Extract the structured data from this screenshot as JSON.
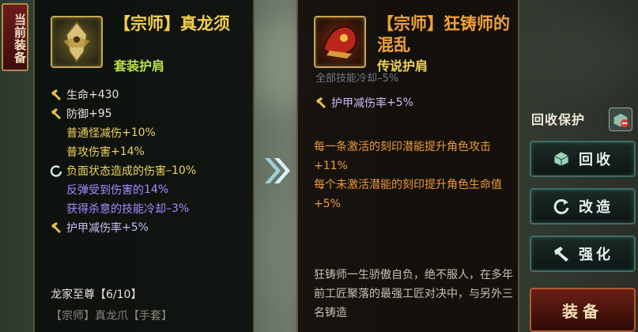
{
  "equip_tag": "当前装备",
  "left_item": {
    "name": "【宗师】真龙须",
    "type": "套装护肩",
    "stats": [
      {
        "kind": "main",
        "icon": "hammer-icon",
        "label": "生命",
        "value": "+430",
        "color": "white"
      },
      {
        "kind": "main",
        "icon": "hammer-icon",
        "label": "防御",
        "value": "+95",
        "color": "white"
      },
      {
        "kind": "sub",
        "icon": "",
        "label": "普通怪减伤",
        "value": "+10%",
        "color": "yellow"
      },
      {
        "kind": "sub",
        "icon": "",
        "label": "普攻伤害",
        "value": "+14%",
        "color": "yellow"
      },
      {
        "kind": "sub",
        "icon": "refresh-icon",
        "label": "负面状态造成的伤害",
        "value": "–10%",
        "color": "yellow"
      },
      {
        "kind": "sub",
        "icon": "",
        "label": "反弹受到伤害的",
        "value": "14%",
        "color": "purple"
      },
      {
        "kind": "sub",
        "icon": "",
        "label": "获得杀意的技能冷却",
        "value": "–3%",
        "color": "purple"
      },
      {
        "kind": "sub",
        "icon": "hammer-icon",
        "label": "护甲减伤率",
        "value": "+5%",
        "color": "lavender"
      }
    ],
    "set_title": "龙家至尊【6/10】",
    "set_item": "【宗师】真龙爪【手套】"
  },
  "right_item": {
    "name": "【宗师】狂铸师的混乱",
    "type": "传说护肩",
    "partial_stat": "全部技能冷却–5%",
    "stat": {
      "label": "护甲减伤率",
      "value": "+5%"
    },
    "desc": "每一条激活的刻印潜能提升角色攻击+11%\n每个未激活潜能的刻印提升角色生命值+5%",
    "lore": "狂铸师一生骄傲自负，绝不服人，在多年前工匠聚落的最强工匠对决中，与另外三名铸造"
  },
  "actions": {
    "recycle_protect": "回收保护",
    "recycle": "回收",
    "reforge": "改造",
    "enhance": "强化",
    "equip": "装备"
  },
  "colors": {
    "left_name": "#f5cf49",
    "right_name": "#f0a23c",
    "desc": "#ef9a3a",
    "button_border": "#3e6d66"
  }
}
